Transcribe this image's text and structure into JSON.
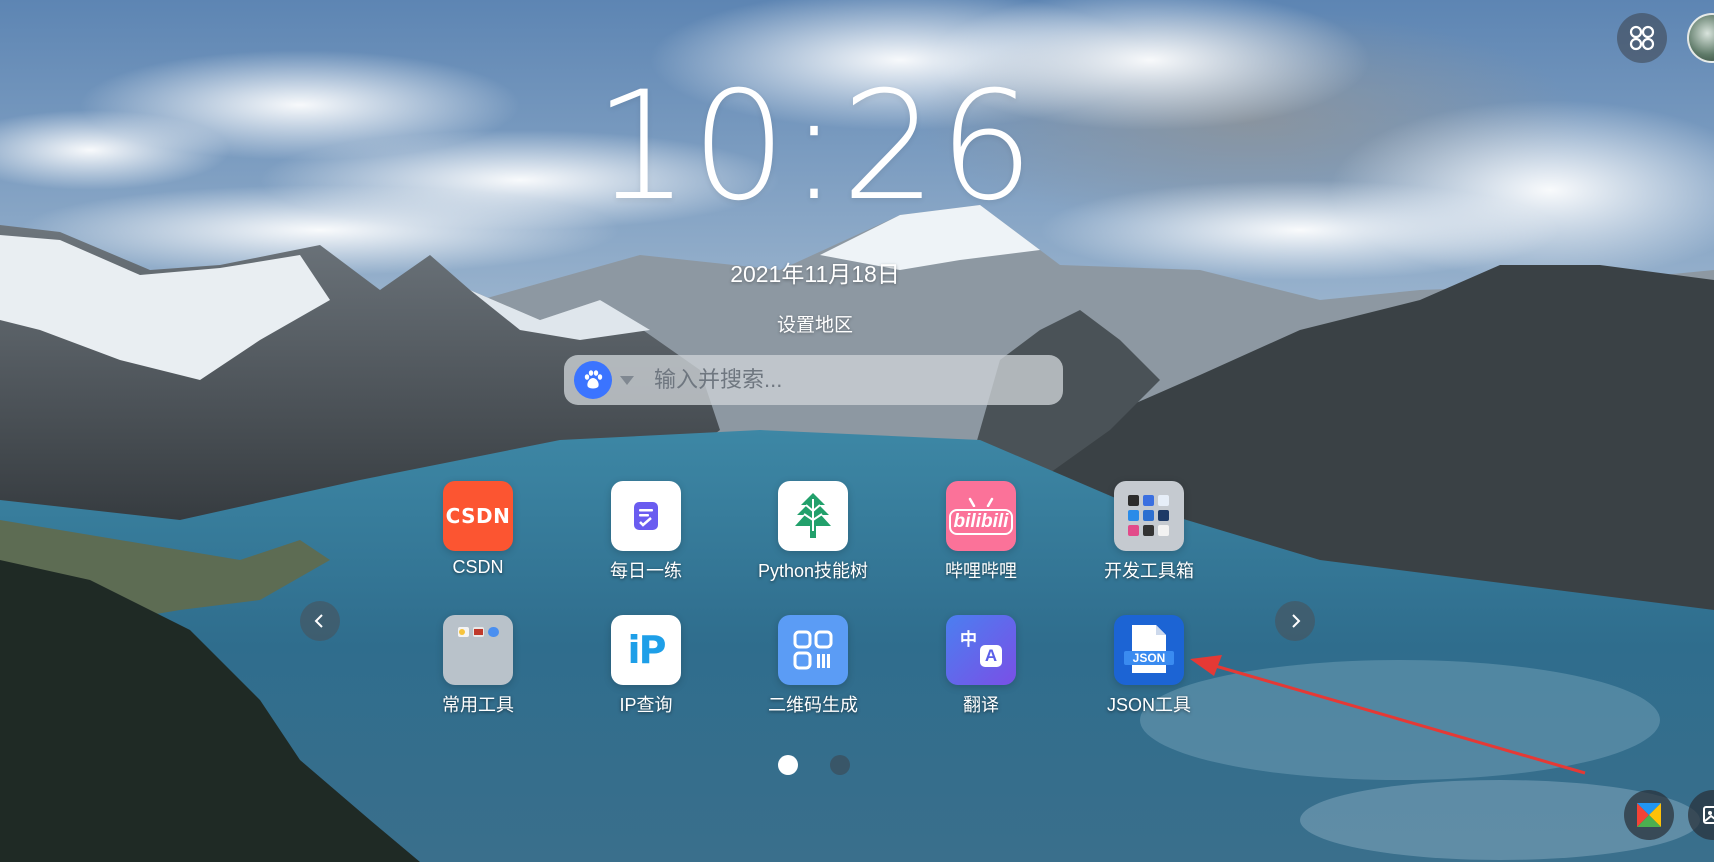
{
  "clock": {
    "time": "10:26",
    "date": "2021年11月18日",
    "region_label": "设置地区"
  },
  "search": {
    "placeholder": "输入并搜索...",
    "engine_icon": "baidu-paw-icon"
  },
  "apps": [
    {
      "id": "csdn",
      "label": "CSDN",
      "tile_text": "CSDN",
      "icon": "csdn-icon",
      "color": "#fc5531"
    },
    {
      "id": "daily",
      "label": "每日一练",
      "icon": "notepad-check-icon",
      "color": "#ffffff"
    },
    {
      "id": "python",
      "label": "Python技能树",
      "icon": "tree-icon",
      "color": "#ffffff"
    },
    {
      "id": "bilibili",
      "label": "哔哩哔哩",
      "tile_text": "bilibili",
      "icon": "bilibili-icon",
      "color": "#fb7299"
    },
    {
      "id": "devtools",
      "label": "开发工具箱",
      "icon": "folder-grid-icon",
      "color": "#c5cad0"
    },
    {
      "id": "common",
      "label": "常用工具",
      "icon": "folder-grid-icon",
      "color": "#b9c2ca"
    },
    {
      "id": "ip",
      "label": "IP查询",
      "tile_text": "iP",
      "icon": "ip-icon",
      "color": "#ffffff"
    },
    {
      "id": "qrcode",
      "label": "二维码生成",
      "icon": "qr-code-icon",
      "color": "#5b9cf5"
    },
    {
      "id": "translate",
      "label": "翻译",
      "tile_text_1": "中",
      "tile_text_2": "A",
      "icon": "translate-icon",
      "color": "#5b5fe8"
    },
    {
      "id": "json",
      "label": "JSON工具",
      "tile_text": "JSON",
      "icon": "json-file-icon",
      "color": "#1c64d4"
    }
  ],
  "pager": {
    "pages": 2,
    "active_page": 1
  },
  "annotation": {
    "color": "#e53935",
    "target": "JSON工具"
  }
}
